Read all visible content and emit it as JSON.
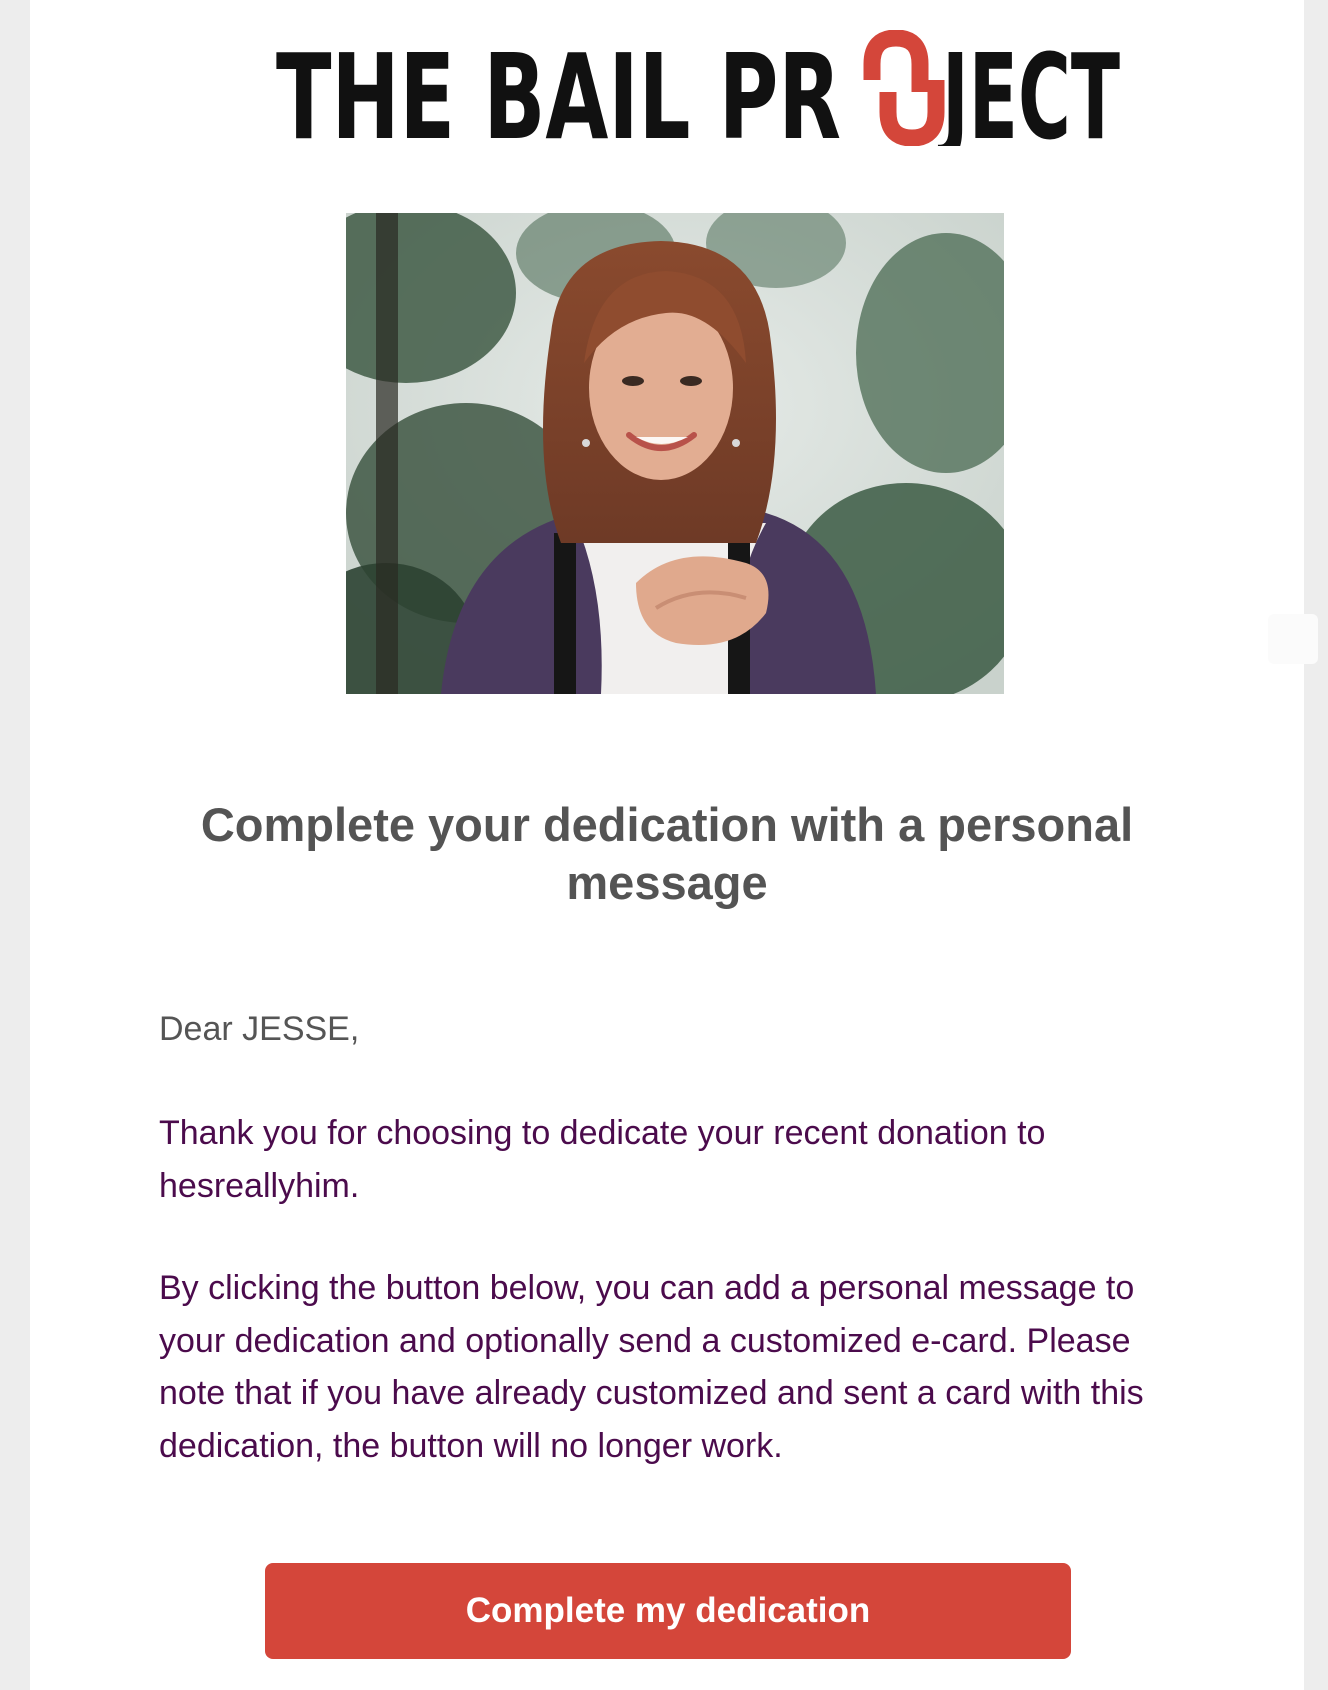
{
  "logo": {
    "text_part1": "THE BAIL PR",
    "text_part2": "JECT",
    "brand_color": "#d4463a"
  },
  "hero": {
    "icon": "photo-portrait"
  },
  "content": {
    "headline": "Complete your dedication with a personal message",
    "greeting": "Dear JESSE,",
    "paragraph_1": "Thank you for choosing to dedicate your recent donation to hesreallyhim.",
    "paragraph_2": "By clicking the button below, you can add a personal message to your dedication and optionally send a customized e-card. Please note that if you have already customized and sent a card with this dedication, the button will no longer work."
  },
  "cta": {
    "label": "Complete my dedication",
    "color": "#d4463a"
  },
  "colors": {
    "headline": "#545454",
    "greeting": "#555555",
    "body_text": "#4b0b4c",
    "background": "#ededed",
    "card": "#ffffff"
  }
}
